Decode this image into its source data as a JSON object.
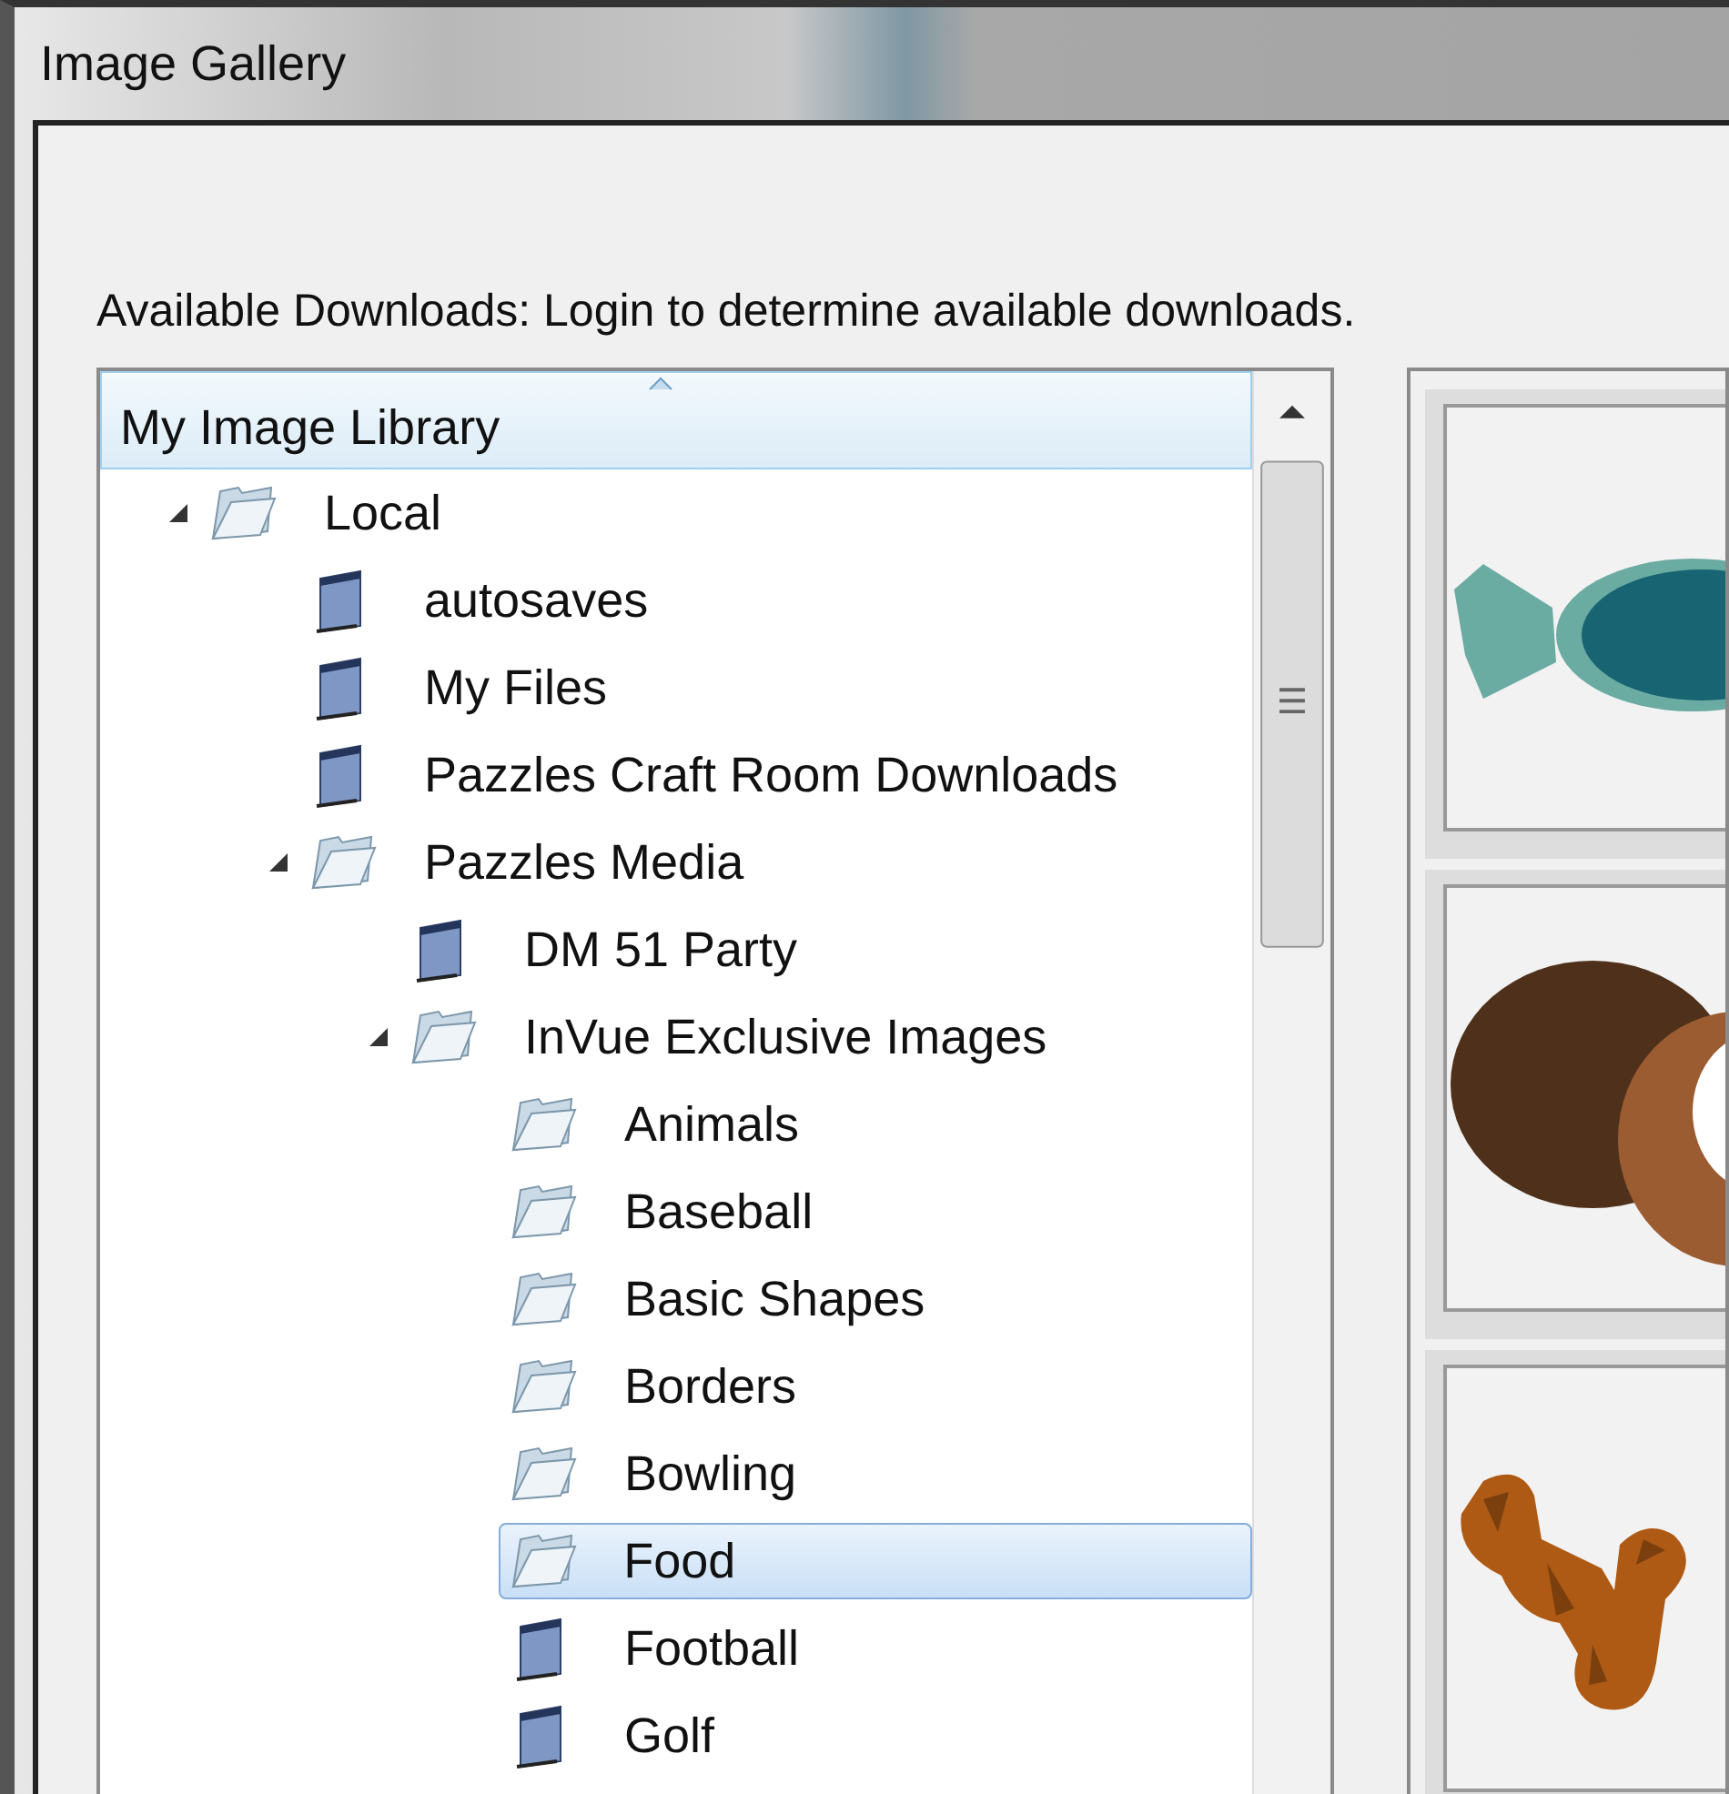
{
  "window": {
    "title": "Image Gallery"
  },
  "downloads_notice": "Available Downloads: Login to determine available downloads.",
  "tree": {
    "header": "My Image Library",
    "items": [
      {
        "label": "Local",
        "kind": "folder",
        "expanded": true,
        "selected": false,
        "children": [
          {
            "label": "autosaves",
            "kind": "library",
            "selected": false
          },
          {
            "label": "My Files",
            "kind": "library",
            "selected": false
          },
          {
            "label": "Pazzles Craft Room Downloads",
            "kind": "library",
            "selected": false
          },
          {
            "label": "Pazzles Media",
            "kind": "folder",
            "expanded": true,
            "selected": false,
            "children": [
              {
                "label": "DM 51 Party",
                "kind": "library",
                "selected": false
              },
              {
                "label": "InVue Exclusive Images",
                "kind": "folder",
                "expanded": true,
                "selected": false,
                "children": [
                  {
                    "label": "Animals",
                    "kind": "folder",
                    "selected": false
                  },
                  {
                    "label": "Baseball",
                    "kind": "folder",
                    "selected": false
                  },
                  {
                    "label": "Basic Shapes",
                    "kind": "folder",
                    "selected": false
                  },
                  {
                    "label": "Borders",
                    "kind": "folder",
                    "selected": false
                  },
                  {
                    "label": "Bowling",
                    "kind": "folder",
                    "selected": false
                  },
                  {
                    "label": "Food",
                    "kind": "folder",
                    "selected": true
                  },
                  {
                    "label": "Football",
                    "kind": "library",
                    "selected": false
                  },
                  {
                    "label": "Golf",
                    "kind": "library",
                    "selected": false
                  }
                ]
              }
            ]
          }
        ]
      }
    ]
  }
}
